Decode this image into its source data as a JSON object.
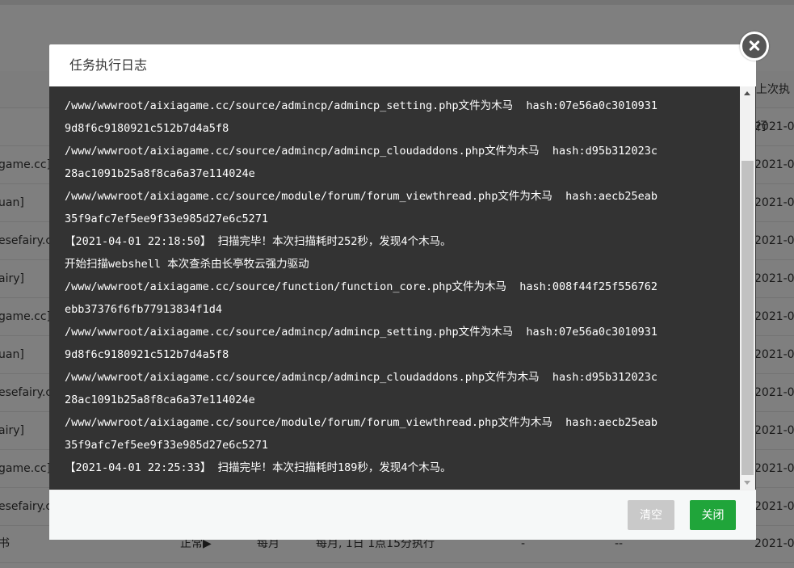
{
  "background": {
    "header_last_run": "上次执行",
    "rows": [
      {
        "name": "",
        "date": "2021-0"
      },
      {
        "name": "game.cc]",
        "date": "2021-0"
      },
      {
        "name": "uan]",
        "date": "2021-0"
      },
      {
        "name": "esefairy.c",
        "date": "2021-0"
      },
      {
        "name": "airy]",
        "date": "2021-0"
      },
      {
        "name": "game.cc]",
        "date": "2021-0"
      },
      {
        "name": "uan]",
        "date": "2021-0"
      },
      {
        "name": "esefairy.c",
        "date": "2021-0"
      },
      {
        "name": "airy]",
        "date": "2021-0"
      },
      {
        "name": "game.cc]",
        "date": "2021-0"
      },
      {
        "name": "esefairy.c",
        "date": "2021-0"
      }
    ],
    "last_row": {
      "name": "书",
      "status": "正常▶",
      "cycle": "每月",
      "schedule": "每月, 1日 1点15分执行",
      "col5": "-",
      "col6": "--",
      "date": "2021-0"
    }
  },
  "dialog": {
    "title": "任务执行日志",
    "log_lines": [
      "ebb37376f6fb77913834f1d4",
      "/www/wwwroot/aixiagame.cc/source/admincp/admincp_setting.php文件为木马  hash:07e56a0c3010931",
      "9d8f6c9180921c512b7d4a5f8",
      "/www/wwwroot/aixiagame.cc/source/admincp/admincp_cloudaddons.php文件为木马  hash:d95b312023c",
      "28ac1091b25a8f8ca6a37e114024e",
      "/www/wwwroot/aixiagame.cc/source/module/forum/forum_viewthread.php文件为木马  hash:aecb25eab",
      "35f9afc7ef5ee9f33e985d27e6c5271",
      "【2021-04-01 22:18:50】 扫描完毕！本次扫描耗时252秒，发现4个木马。",
      "开始扫描webshell 本次查杀由长亭牧云强力驱动",
      "/www/wwwroot/aixiagame.cc/source/function/function_core.php文件为木马  hash:008f44f25f556762",
      "ebb37376f6fb77913834f1d4",
      "/www/wwwroot/aixiagame.cc/source/admincp/admincp_setting.php文件为木马  hash:07e56a0c3010931",
      "9d8f6c9180921c512b7d4a5f8",
      "/www/wwwroot/aixiagame.cc/source/admincp/admincp_cloudaddons.php文件为木马  hash:d95b312023c",
      "28ac1091b25a8f8ca6a37e114024e",
      "/www/wwwroot/aixiagame.cc/source/module/forum/forum_viewthread.php文件为木马  hash:aecb25eab",
      "35f9afc7ef5ee9f33e985d27e6c5271",
      "【2021-04-01 22:25:33】 扫描完毕！本次扫描耗时189秒，发现4个木马。"
    ],
    "buttons": {
      "clear": "清空",
      "close": "关闭"
    }
  },
  "colors": {
    "log_bg": "#333333",
    "primary": "#20a53a",
    "disabled": "#c9c9c9"
  }
}
